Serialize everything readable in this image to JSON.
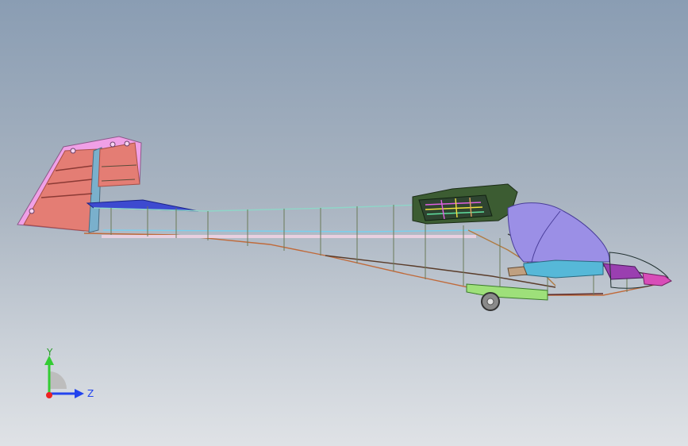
{
  "viewport": {
    "background_top": "#8a9db3",
    "background_bottom": "#dfe2e6"
  },
  "model": {
    "colors": {
      "rudder": "#f0a0e6",
      "fin": "#e47d74",
      "stringers": "#505a40",
      "canopy": "#9b8fe6",
      "wing_root": "#3c5c32",
      "instrument_panel": "#9a3fb0",
      "cockpit_tub": "#56b8d8",
      "skid": "#9ee07a",
      "nose": "#d84db8"
    }
  },
  "triad": {
    "y_label": "Y",
    "z_label": "Z",
    "y_color": "#33cc33",
    "z_color": "#2244ee",
    "x_color": "#ee2222"
  }
}
